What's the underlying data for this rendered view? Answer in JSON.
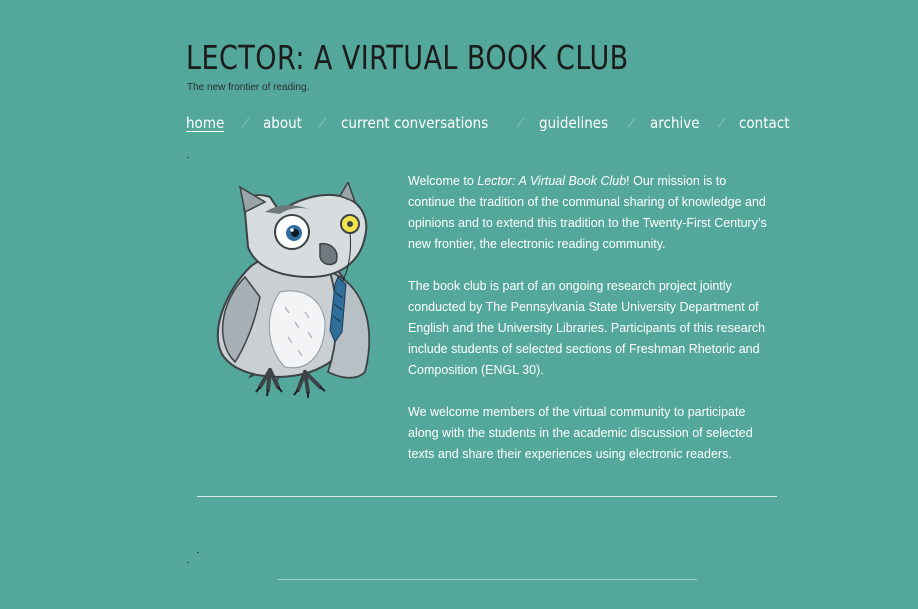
{
  "header": {
    "title": "LECTOR: A VIRTUAL BOOK CLUB",
    "tagline": "The new frontier of reading."
  },
  "nav": {
    "items": [
      {
        "label": "home",
        "active": true
      },
      {
        "label": "about"
      },
      {
        "label": "current conversations"
      },
      {
        "label": "guidelines"
      },
      {
        "label": "archive"
      },
      {
        "label": "contact"
      }
    ],
    "separator": "/"
  },
  "main": {
    "image": {
      "icon": "owl-illustration"
    },
    "welcome_prefix": "Welcome to ",
    "welcome_title": "Lector: A Virtual Book Club",
    "welcome_rest": "! Our mission is to continue the tradition of the communal sharing of knowledge and opinions and to extend this tradition to the Twenty-First Century’s new frontier, the electronic reading community.",
    "paragraph2": "The book club is part of an ongoing research project jointly conducted by The Pennsylvania State University Department of English and the University Libraries. Participants of this research include students of selected sections of Freshman Rhetoric and Composition (ENGL 30).",
    "paragraph3": "We welcome members of the virtual community to participate along with the students in the academic discussion of selected texts and share their experiences using electronic readers."
  },
  "colors": {
    "background": "#54a89b",
    "title": "#1b1b1b",
    "text": "#ffffff"
  }
}
